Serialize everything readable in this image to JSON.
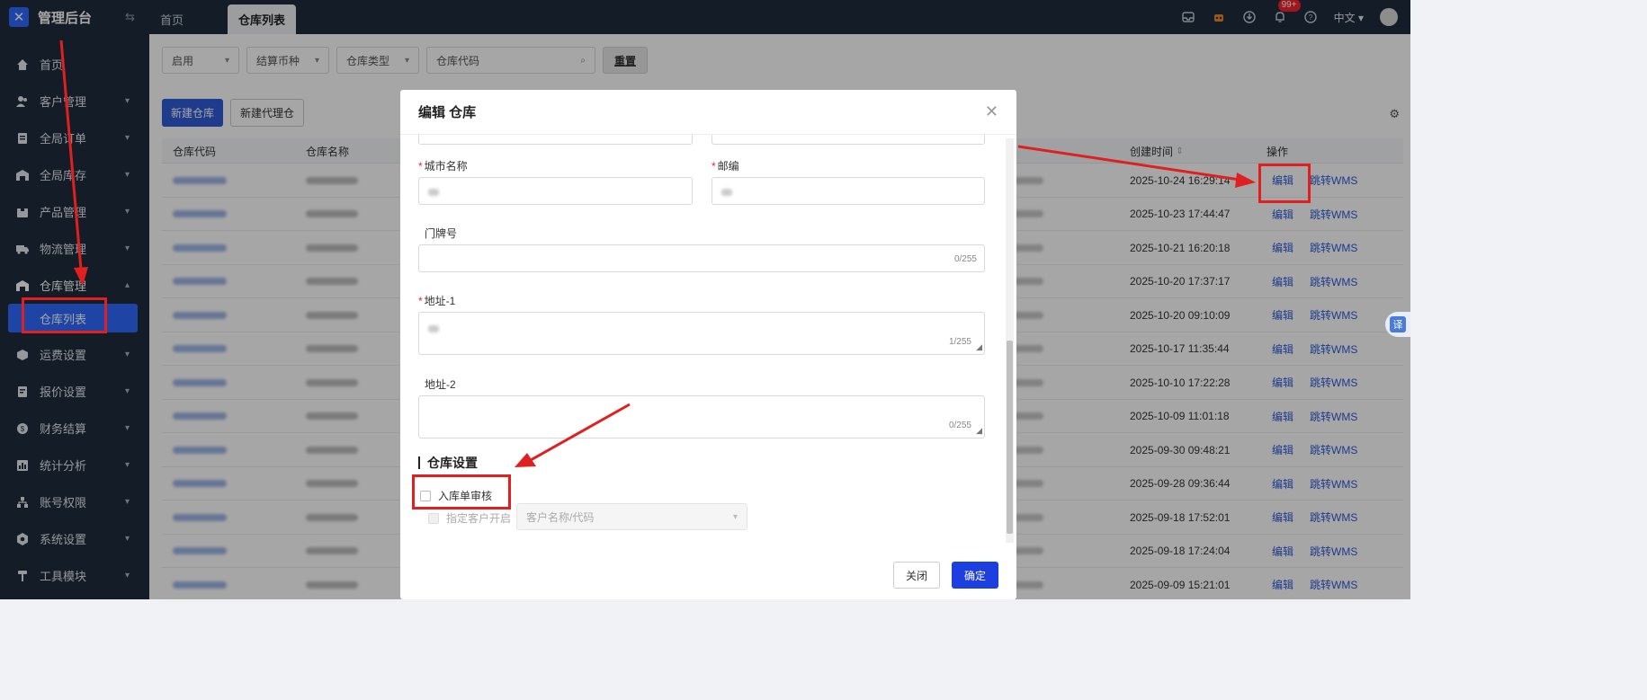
{
  "app": {
    "title": "管理后台"
  },
  "sidebar": {
    "items": [
      {
        "label": "首页",
        "icon": "home-icon"
      },
      {
        "label": "客户管理",
        "icon": "users-icon"
      },
      {
        "label": "全局订单",
        "icon": "order-icon"
      },
      {
        "label": "全局库存",
        "icon": "warehouse-icon"
      },
      {
        "label": "产品管理",
        "icon": "product-icon"
      },
      {
        "label": "物流管理",
        "icon": "truck-icon"
      },
      {
        "label": "仓库管理",
        "icon": "warehouse-icon"
      },
      {
        "label": "运费设置",
        "icon": "shipping-icon"
      },
      {
        "label": "报价设置",
        "icon": "quote-icon"
      },
      {
        "label": "财务结算",
        "icon": "finance-icon"
      },
      {
        "label": "统计分析",
        "icon": "chart-icon"
      },
      {
        "label": "账号权限",
        "icon": "account-icon"
      },
      {
        "label": "系统设置",
        "icon": "gear-icon"
      },
      {
        "label": "工具模块",
        "icon": "tool-icon"
      }
    ],
    "active_sub": "仓库列表"
  },
  "topbar": {
    "tabs": [
      "首页",
      "仓库列表"
    ],
    "badge": "99+",
    "language": "中文"
  },
  "filters": {
    "status": "启用",
    "currency_placeholder": "结算币种",
    "type_placeholder": "仓库类型",
    "code_placeholder": "仓库代码",
    "reset": "重置"
  },
  "actions": {
    "new_warehouse": "新建仓库",
    "new_agent_warehouse": "新建代理仓"
  },
  "table": {
    "headers": {
      "code": "仓库代码",
      "name": "仓库名称",
      "created": "创建时间",
      "ops": "操作"
    },
    "rows": [
      {
        "created": "2025-10-24 16:29:14"
      },
      {
        "created": "2025-10-23 17:44:47"
      },
      {
        "created": "2025-10-21 16:20:18"
      },
      {
        "created": "2025-10-20 17:37:17"
      },
      {
        "created": "2025-10-20 09:10:09"
      },
      {
        "created": "2025-10-17 11:35:44"
      },
      {
        "created": "2025-10-10 17:22:28"
      },
      {
        "created": "2025-10-09 11:01:18"
      },
      {
        "created": "2025-09-30 09:48:21"
      },
      {
        "created": "2025-09-28 09:36:44"
      },
      {
        "created": "2025-09-18 17:52:01"
      },
      {
        "created": "2025-09-18 17:24:04"
      },
      {
        "created": "2025-09-09 15:21:01"
      }
    ],
    "edit_label": "编辑",
    "wms_label": "跳转WMS"
  },
  "modal": {
    "title": "编辑 仓库",
    "city_label": "城市名称",
    "zip_label": "邮编",
    "door_label": "门牌号",
    "door_counter": "0/255",
    "addr1_label": "地址-1",
    "addr1_counter": "1/255",
    "addr2_label": "地址-2",
    "addr2_counter": "0/255",
    "section_title": "仓库设置",
    "inbound_review": "入库单审核",
    "customer_enable": "指定客户开启",
    "customer_placeholder": "客户名称/代码",
    "close": "关闭",
    "confirm": "确定"
  },
  "translate": "译",
  "colors": {
    "sidebar_bg": "#1f2d3d",
    "primary": "#2f5bd8",
    "annotation": "#e02020"
  }
}
